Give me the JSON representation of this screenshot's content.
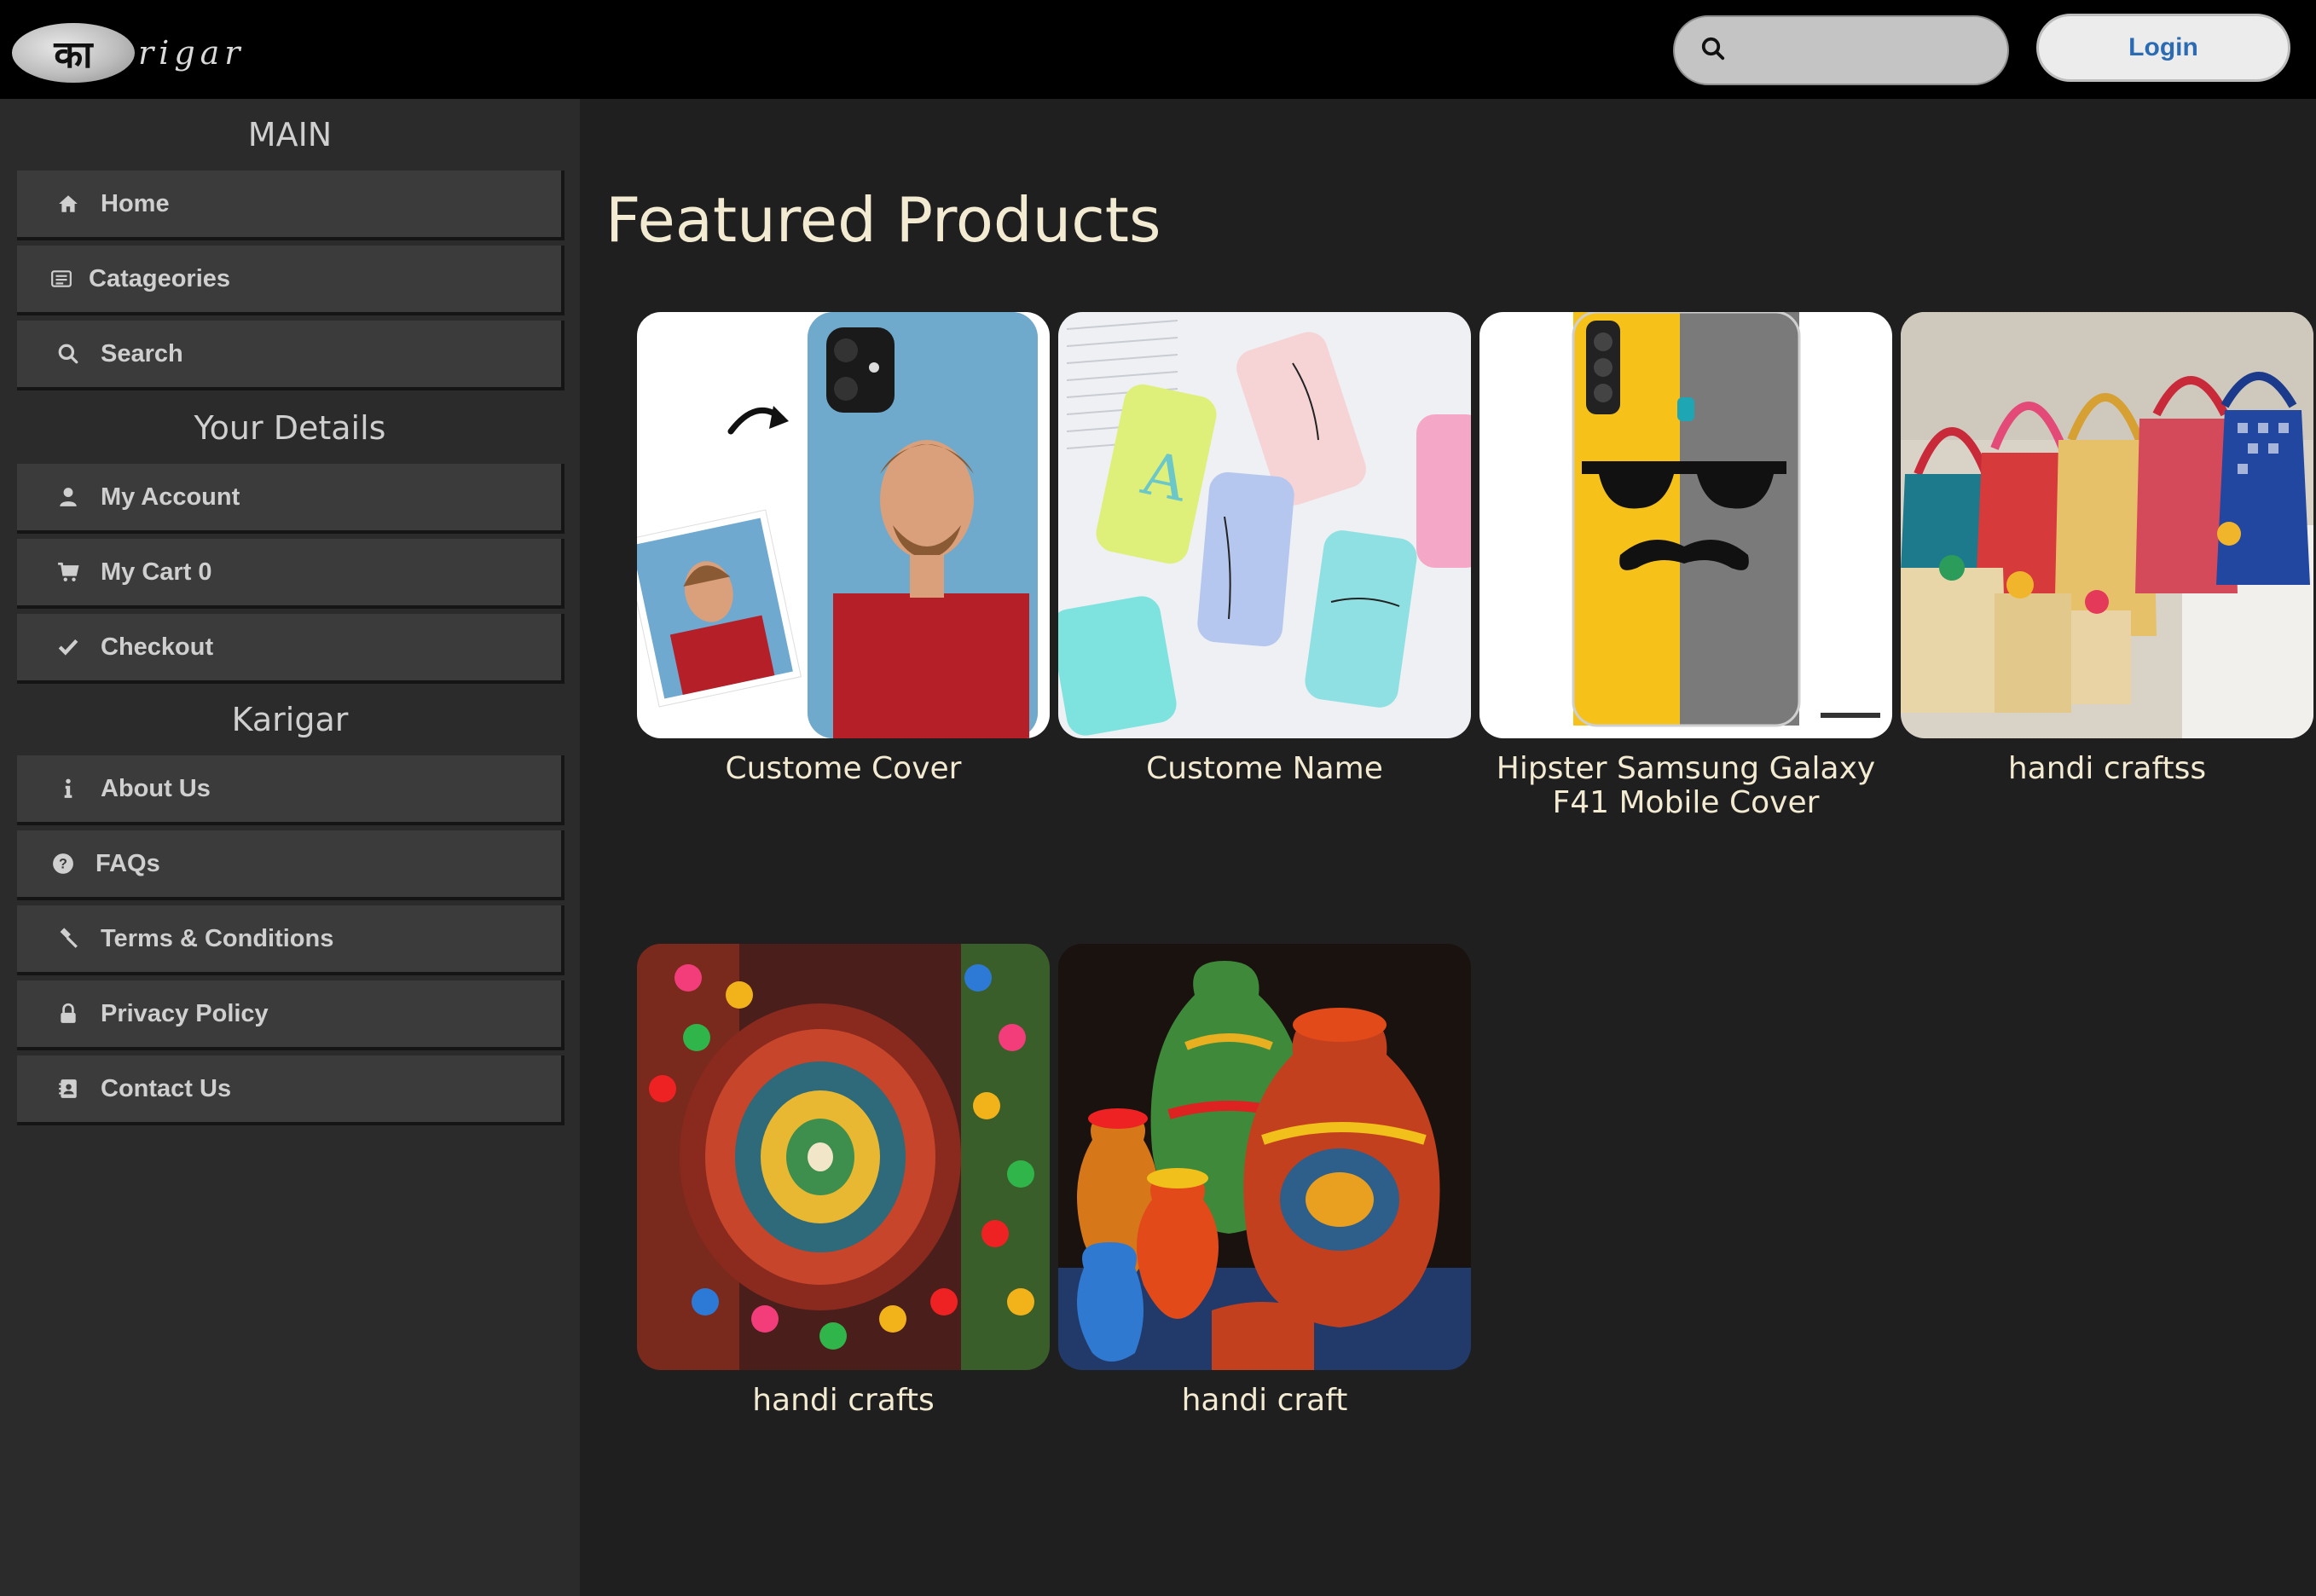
{
  "header": {
    "logo_text": "कारीगर",
    "logo_glyph": "का",
    "logo_rest": "rigar",
    "search_placeholder": "",
    "login_label": "Login"
  },
  "sidebar": {
    "sections": [
      {
        "title": "MAIN",
        "items": [
          {
            "label": "Home",
            "icon": "home-icon"
          },
          {
            "label": "Catageories",
            "icon": "list-icon"
          },
          {
            "label": "Search",
            "icon": "search-icon"
          }
        ]
      },
      {
        "title": "Your Details",
        "items": [
          {
            "label": "My Account",
            "icon": "user-icon"
          },
          {
            "label": "My Cart 0",
            "icon": "cart-icon"
          },
          {
            "label": "Checkout",
            "icon": "check-icon"
          }
        ]
      },
      {
        "title": "Karigar",
        "items": [
          {
            "label": "About Us",
            "icon": "info-icon"
          },
          {
            "label": "FAQs",
            "icon": "question-icon"
          },
          {
            "label": "Terms & Conditions",
            "icon": "gavel-icon"
          },
          {
            "label": "Privacy Policy",
            "icon": "lock-icon"
          },
          {
            "label": "Contact Us",
            "icon": "address-book-icon"
          }
        ]
      }
    ]
  },
  "main": {
    "title": "Featured Products",
    "products": [
      {
        "name": "Custome Cover",
        "image": "custom-photo-phone-cover"
      },
      {
        "name": "Custome Name",
        "image": "custom-name-phone-covers"
      },
      {
        "name": "Hipster Samsung Galaxy F41 Mobile Cover",
        "image": "hipster-mobile-cover"
      },
      {
        "name": "handi craftss",
        "image": "handmade-baskets"
      },
      {
        "name": "handi crafts",
        "image": "embroidered-textile"
      },
      {
        "name": "handi craft",
        "image": "painted-pottery"
      }
    ]
  },
  "colors": {
    "topbar": "#000000",
    "sidebar": "#2b2b2b",
    "nav_button": "#3b3b3b",
    "main_bg": "#1f1f1f",
    "title_text": "#f3ead2",
    "login_text": "#2a6bb4"
  }
}
